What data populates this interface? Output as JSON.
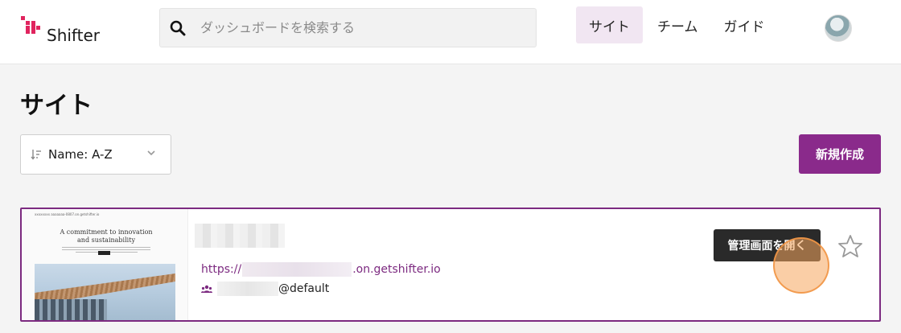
{
  "header": {
    "brand": "Shifter",
    "search_placeholder": "ダッシュボードを検索する",
    "nav": [
      {
        "label": "サイト",
        "active": true
      },
      {
        "label": "チーム",
        "active": false
      },
      {
        "label": "ガイド",
        "active": false
      }
    ]
  },
  "page": {
    "title": "サイト",
    "sort_label": "Name: A-Z",
    "new_button": "新規作成"
  },
  "site_card": {
    "thumbnail": {
      "tiny_header": "xxxxxxxx aaaaaaa-0807.on.getshifter.io",
      "headline": "A commitment to innovation and sustainability"
    },
    "url_prefix": "https://",
    "url_suffix": ".on.getshifter.io",
    "team_suffix": "@default",
    "admin_button": "管理画面を開く"
  },
  "colors": {
    "brand": "#e0245e",
    "accent_purple": "#8a2a8b",
    "nav_active_bg": "#f1e6f2",
    "click_marker": "#f5a65c"
  },
  "icons": [
    "shifter-logo-icon",
    "search-icon",
    "sort-icon",
    "chevron-down-icon",
    "team-icon",
    "star-icon"
  ]
}
